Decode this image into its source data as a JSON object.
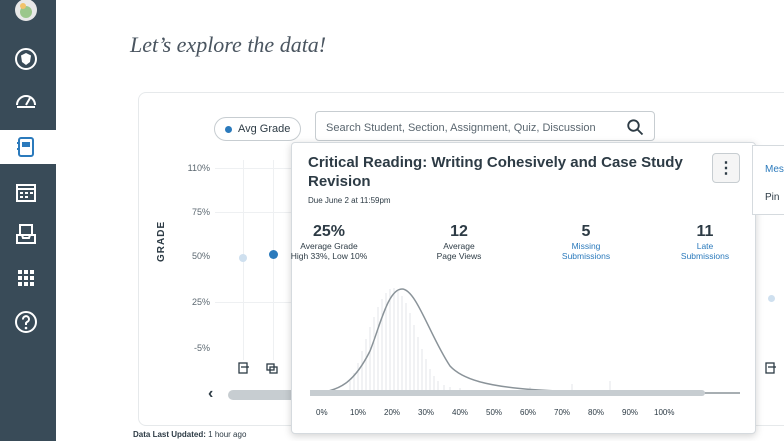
{
  "page": {
    "title": "Let’s explore the data!",
    "last_updated_label": "Data Last Updated:",
    "last_updated_value": "1 hour ago"
  },
  "sidebar": {
    "items": [
      {
        "icon": "avatar-icon"
      },
      {
        "icon": "badge-icon"
      },
      {
        "icon": "dashboard-icon"
      },
      {
        "icon": "gradebook-icon",
        "active": true
      },
      {
        "icon": "calendar-icon"
      },
      {
        "icon": "inbox-icon"
      },
      {
        "icon": "apps-grid-icon"
      },
      {
        "icon": "help-icon"
      }
    ],
    "bg_color": "#394b58"
  },
  "chart_controls": {
    "legend_label": "Avg Grade",
    "search_placeholder": "Search Student, Section, Assignment, Quiz, Discussion"
  },
  "main_chart": {
    "y_axis_title": "GRADE",
    "y_ticks": [
      "110%",
      "75%",
      "50%",
      "25%",
      "-5%"
    ]
  },
  "popover": {
    "title": "Critical Reading: Writing Cohesively and Case Study Revision",
    "due": "Due June 2 at 11:59pm",
    "menu_icon": "⋮",
    "stats": [
      {
        "value": "25%",
        "label1": "Average Grade",
        "label2": "High 33%, Low 10%",
        "link": false
      },
      {
        "value": "12",
        "label1": "Average",
        "label2": "Page Views",
        "link": false
      },
      {
        "value": "5",
        "label1": "Missing",
        "label2": "Submissions",
        "link": true
      },
      {
        "value": "11",
        "label1": "Late",
        "label2": "Submissions",
        "link": true
      }
    ],
    "x_ticks": [
      "0%",
      "10%",
      "20%",
      "30%",
      "40%",
      "50%",
      "60%",
      "70%",
      "80%",
      "90%",
      "100%"
    ]
  },
  "side_menu": {
    "item1": "Mes",
    "item2": "Pin"
  },
  "colors": {
    "accent": "#2b7abc",
    "text": "#2d3b45"
  }
}
